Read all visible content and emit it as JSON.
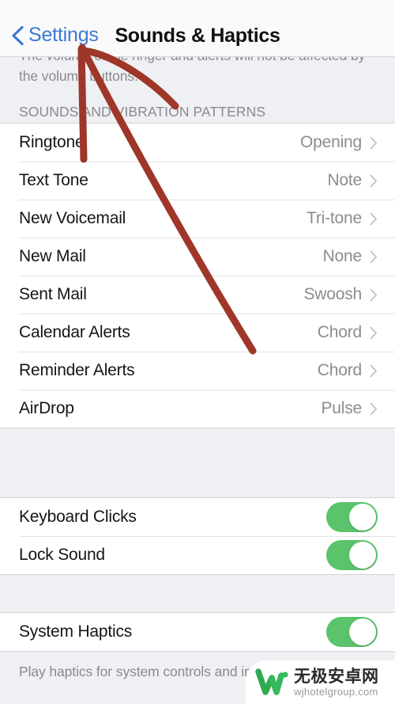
{
  "navbar": {
    "back_label": "Settings",
    "back_icon": "chevron-left-icon",
    "title": "Sounds & Haptics"
  },
  "top_note": "The volume of the ringer and alerts will not be affected by the volume buttons.",
  "sounds_section": {
    "header": "SOUNDS AND VIBRATION PATTERNS",
    "rows": [
      {
        "label": "Ringtone",
        "value": "Opening"
      },
      {
        "label": "Text Tone",
        "value": "Note"
      },
      {
        "label": "New Voicemail",
        "value": "Tri-tone"
      },
      {
        "label": "New Mail",
        "value": "None"
      },
      {
        "label": "Sent Mail",
        "value": "Swoosh"
      },
      {
        "label": "Calendar Alerts",
        "value": "Chord"
      },
      {
        "label": "Reminder Alerts",
        "value": "Chord"
      },
      {
        "label": "AirDrop",
        "value": "Pulse"
      }
    ]
  },
  "toggles_section": {
    "rows": [
      {
        "label": "Keyboard Clicks",
        "state": "on"
      },
      {
        "label": "Lock Sound",
        "state": "on"
      }
    ]
  },
  "haptics_section": {
    "rows": [
      {
        "label": "System Haptics",
        "state": "on"
      }
    ],
    "footer": "Play haptics for system controls and in"
  },
  "watermark": {
    "cn_name": "无极安卓网",
    "url": "wjhotelgroup.com",
    "logo_icon": "w-logo-icon"
  },
  "annotation": {
    "shape": "arrow",
    "color": "#9e3629",
    "points_to": "Settings"
  },
  "colors": {
    "accent_blue": "#3b7ad4",
    "toggle_green": "#5ac36b",
    "value_gray": "#8c8c91",
    "separator": "#e2e2e6",
    "group_background": "#eff0f3",
    "annotation_red": "#9e3629"
  }
}
